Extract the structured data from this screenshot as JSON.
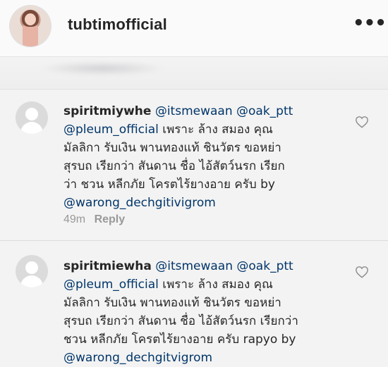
{
  "header": {
    "username": "tubtimofficial",
    "more_icon": "more-horizontal-icon"
  },
  "comments": [
    {
      "author": "spiritmiywhe",
      "mentions_line1": "@itsmewaan @oak_ptt",
      "mention_line2": "@pleum_official",
      "line2_rest": " เพราะ ล้าง สมอง คุณ",
      "line3": "มัลลิกา รับเงิน พานทองแท้ ชินวัตร ขอหย่า",
      "line4": "สุรบถ เรียกว่า สันดาน ชื่อ ไอ้สัตว์นรก เรียก",
      "line5": "ว่า ชวน หลีกภัย โครตไร้ยางอาย ครับ by",
      "line6_mention": "@warong_dechgitivigrom",
      "time": "49m",
      "reply_label": "Reply",
      "like_icon": "heart-outline-icon"
    },
    {
      "author": "spiritmiewha",
      "mentions_line1": "@itsmewaan @oak_ptt",
      "mention_line2": "@pleum_official",
      "line2_rest": " เพราะ ล้าง สมอง คุณ",
      "line3": "มัลลิกา รับเงิน พานทองแท้ ชินวัตร ขอหย่า",
      "line4": "สุรบถ เรียกว่า สันดาน ชื่อ ไอ้สัตว์นรก เรียกว่า",
      "line5": "ชวน หลีกภัย โครตไร้ยางอาย ครับ rapyo by",
      "line6_mention": "@warong_dechgitvigrom",
      "like_icon": "heart-outline-icon"
    }
  ],
  "colors": {
    "background": "#f3f3f3",
    "text": "#262626",
    "mention": "#003569",
    "meta": "#999999",
    "avatar_placeholder": "#dbdbdb"
  }
}
